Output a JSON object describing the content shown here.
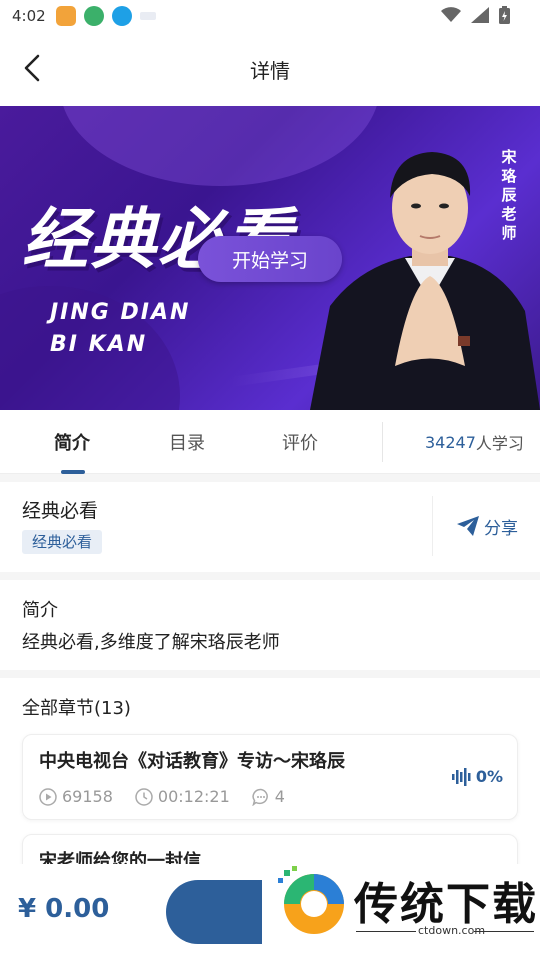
{
  "status_bar": {
    "time": "4:02"
  },
  "header": {
    "title": "详情"
  },
  "banner": {
    "title": "经典必看",
    "subtitle_line1": "JING DIAN",
    "subtitle_line2": "BI KAN",
    "start_button": "开始学习",
    "teacher_name": "宋珞辰老师"
  },
  "tabs": [
    {
      "label": "简介"
    },
    {
      "label": "目录"
    },
    {
      "label": "评价"
    }
  ],
  "learners": {
    "count": "34247",
    "suffix": "人学习"
  },
  "course": {
    "name": "经典必看",
    "tag": "经典必看",
    "share_label": "分享"
  },
  "intro": {
    "heading": "简介",
    "text": "经典必看,多维度了解宋珞辰老师"
  },
  "chapters": {
    "heading": "全部章节(13)",
    "items": [
      {
        "title": "中央电视台《对话教育》专访～宋珞辰",
        "plays": "69158",
        "duration": "00:12:21",
        "comments": "4",
        "progress": "0%"
      },
      {
        "title": "宋老师给您的一封信"
      }
    ]
  },
  "footer": {
    "price": "¥ 0.00"
  },
  "watermark": {
    "text": "传统下载",
    "url": "ctdown.com"
  },
  "colors": {
    "accent": "#2d5f9a",
    "banner": "#4a1b9c"
  }
}
